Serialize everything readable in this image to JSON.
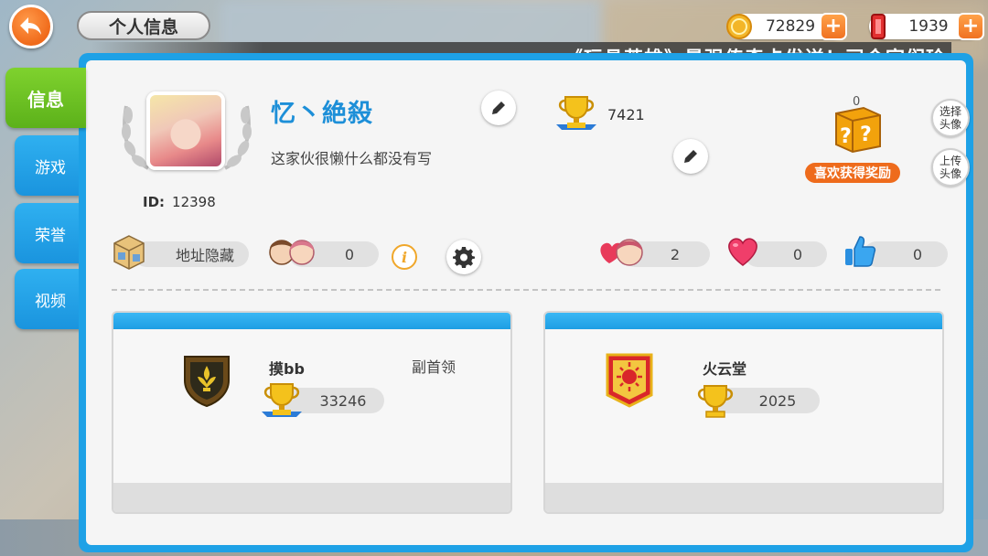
{
  "header": {
    "title": "个人信息",
    "coins": "72829",
    "gems": "1939",
    "marquee": "《玩具英雄》最强传奇卡发送！司令官们珍"
  },
  "tabs": [
    {
      "label": "信息",
      "active": true
    },
    {
      "label": "游戏",
      "active": false
    },
    {
      "label": "荣誉",
      "active": false
    },
    {
      "label": "视频",
      "active": false
    }
  ],
  "profile": {
    "nickname": "忆丶絶殺",
    "signature": "这家伙很懒什么都没有写",
    "id_label": "ID:",
    "id": "12398",
    "trophies": "7421"
  },
  "reward": {
    "count": "0",
    "label": "喜欢获得奖励"
  },
  "side_buttons": {
    "choose_avatar": "选择头像",
    "upload_avatar": "上传头像"
  },
  "stats": {
    "location": "地址隐藏",
    "friends": "0",
    "couple": "2",
    "likes_heart": "0",
    "thumbs_up": "0"
  },
  "guild_card": {
    "name": "摸bb",
    "role": "副首领",
    "trophies": "33246"
  },
  "clan_card": {
    "name": "火云堂",
    "trophies": "2025"
  },
  "colors": {
    "panel_blue": "#1ea1e6",
    "active_tab_green": "#6ac220",
    "accent_orange": "#f07222",
    "nickname_blue": "#1d8fd8"
  }
}
